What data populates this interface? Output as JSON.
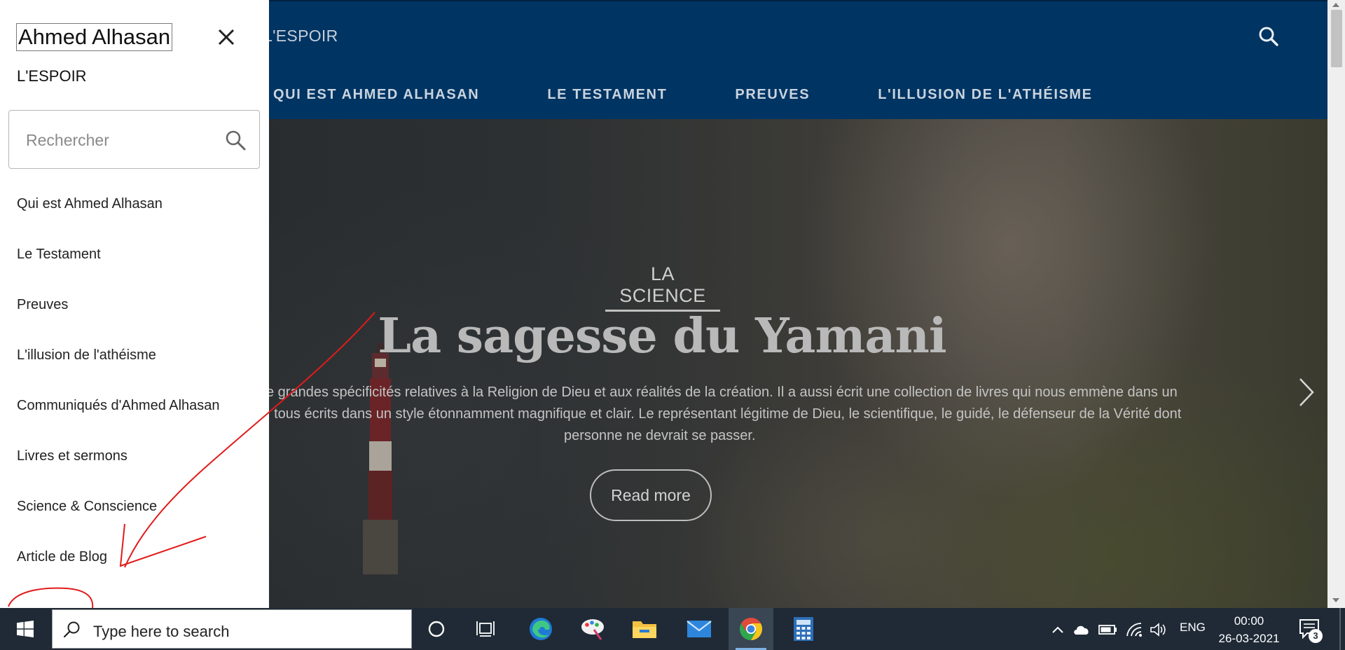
{
  "header": {
    "brand": "L'ESPOIR",
    "nav": [
      "QUI EST AHMED ALHASAN",
      "LE TESTAMENT",
      "PREUVES",
      "L'ILLUSION DE L'ATHÉISME"
    ]
  },
  "hero": {
    "category": "LA SCIENCE",
    "title": "La sagesse du Yamani",
    "description_lines": [
      "e grandes spécificités relatives à la Religion de Dieu et aux réalités de la création. Il a aussi écrit une collection de livres qui nous emmène dans un",
      ", tous écrits dans un style étonnamment magnifique et clair. Le représentant légitime de Dieu, le scientifique, le guidé, le défenseur de la Vérité dont",
      "personne ne devrait se passer."
    ],
    "read_more": "Read more"
  },
  "drawer": {
    "title": "Ahmed Alhasan",
    "brand": "L'ESPOIR",
    "search_placeholder": "Rechercher",
    "menu": [
      "Qui est Ahmed Alhasan",
      "Le Testament",
      "Preuves",
      "L'illusion de l'athéisme",
      "Communiqués d'Ahmed Alhasan",
      "Livres et sermons",
      "Science & Conscience",
      "Article de Blog"
    ]
  },
  "taskbar": {
    "search_text": "Type here to search",
    "apps": [
      "cortana-icon",
      "task-view-icon",
      "edge-icon",
      "paint-icon",
      "file-explorer-icon",
      "mail-icon",
      "chrome-icon",
      "calculator-icon"
    ],
    "active_app": "chrome-icon",
    "language": "ENG",
    "time": "00:00",
    "date": "26-03-2021",
    "notification_count": "3"
  },
  "colors": {
    "header_bg": "#003462",
    "annotation": "#e11b1b",
    "taskbar_bg": "#1f2a36"
  }
}
